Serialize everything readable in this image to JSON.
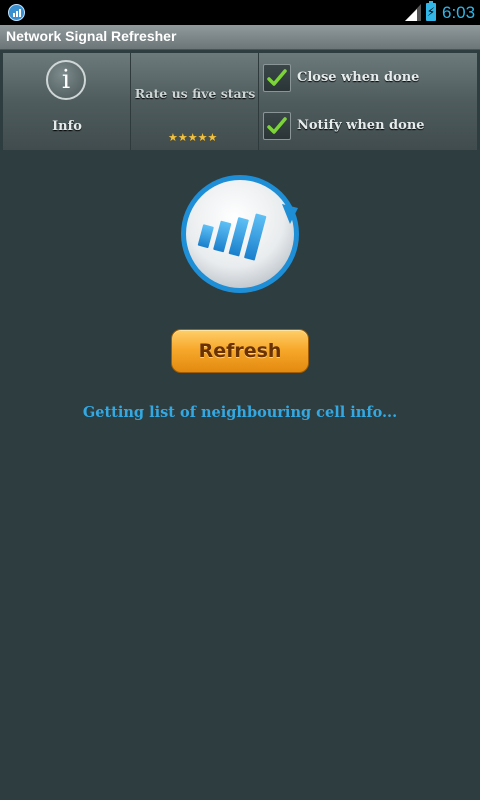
{
  "status_bar": {
    "time": "6:03"
  },
  "title_bar": {
    "title": "Network Signal Refresher"
  },
  "panel": {
    "info_label": "Info",
    "rate_label": "Rate us five stars",
    "stars": "★★★★★",
    "options": [
      {
        "label": "Close when done",
        "checked": true
      },
      {
        "label": "Notify when done",
        "checked": true
      }
    ]
  },
  "main": {
    "refresh_label": "Refresh",
    "status_message": "Getting list of neighbouring cell info..."
  },
  "colors": {
    "accent": "#33a8e2",
    "button": "#f7a92c",
    "background": "#2e3d3f"
  }
}
